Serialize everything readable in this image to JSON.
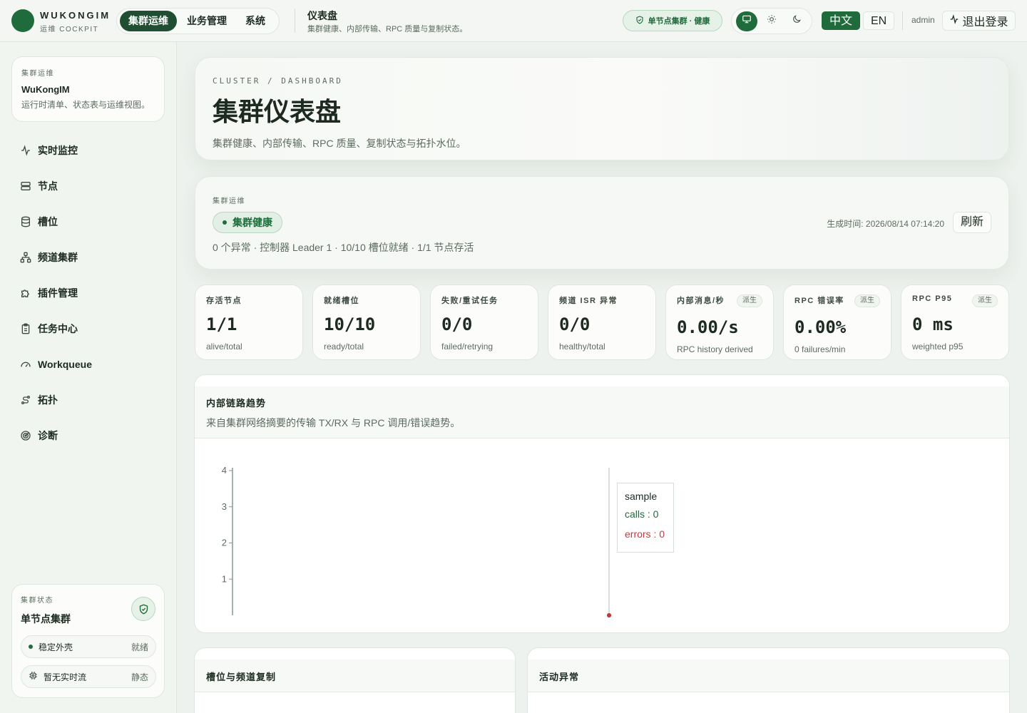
{
  "brand": {
    "name": "WUKONGIM",
    "subtitle": "运维 COCKPIT"
  },
  "topnav": {
    "items": [
      "集群运维",
      "业务管理",
      "系统"
    ],
    "active": 0
  },
  "page_head": {
    "title": "仪表盘",
    "subtitle": "集群健康、内部传输、RPC 质量与复制状态。"
  },
  "cluster_chip": {
    "label": "单节点集群 · 健康"
  },
  "theme": {
    "modes": [
      "monitor-icon",
      "sun-icon",
      "moon-icon"
    ],
    "active": 0
  },
  "lang": {
    "zh": "中文",
    "en": "EN",
    "active": "zh"
  },
  "user": {
    "name": "admin",
    "logout": "退出登录"
  },
  "sidebar": {
    "card": {
      "eyebrow": "集群运维",
      "title": "WuKongIM",
      "subtitle": "运行时清单、状态表与运维视图。"
    },
    "items": [
      {
        "label": "实时监控",
        "icon": "activity-icon"
      },
      {
        "label": "节点",
        "icon": "server-icon"
      },
      {
        "label": "槽位",
        "icon": "database-icon"
      },
      {
        "label": "频道集群",
        "icon": "network-icon"
      },
      {
        "label": "插件管理",
        "icon": "puzzle-icon"
      },
      {
        "label": "任务中心",
        "icon": "clipboard-icon"
      },
      {
        "label": "Workqueue",
        "icon": "gauge-icon"
      },
      {
        "label": "拓扑",
        "icon": "route-icon"
      },
      {
        "label": "诊断",
        "icon": "radar-icon"
      }
    ],
    "status": {
      "eyebrow": "集群状态",
      "title": "单节点集群",
      "rows": [
        {
          "label": "稳定外壳",
          "value": "就绪"
        },
        {
          "label": "暂无实时流",
          "value": "静态"
        }
      ]
    }
  },
  "hero": {
    "eyebrow": "CLUSTER / DASHBOARD",
    "title": "集群仪表盘",
    "subtitle": "集群健康、内部传输、RPC 质量、复制状态与拓扑水位。"
  },
  "ops": {
    "eyebrow": "集群运维",
    "health": "集群健康",
    "summary": "0 个异常 · 控制器 Leader 1 · 10/10 槽位就绪 · 1/1 节点存活",
    "generated_label": "生成时间:",
    "generated_at": "2026/08/14 07:14:20",
    "refresh": "刷新"
  },
  "metrics": [
    {
      "label": "存活节点",
      "value": "1/1",
      "caption": "alive/total",
      "tag": ""
    },
    {
      "label": "就绪槽位",
      "value": "10/10",
      "caption": "ready/total",
      "tag": ""
    },
    {
      "label": "失败/重试任务",
      "value": "0/0",
      "caption": "failed/retrying",
      "tag": ""
    },
    {
      "label": "频道 ISR 异常",
      "value": "0/0",
      "caption": "healthy/total",
      "tag": ""
    },
    {
      "label": "内部消息/秒",
      "value": "0.00/s",
      "caption": "RPC history derived",
      "tag": "派生"
    },
    {
      "label": "RPC 错误率",
      "value": "0.00%",
      "caption": "0 failures/min",
      "tag": "派生"
    },
    {
      "label": "RPC P95",
      "value": "0 ms",
      "caption": "weighted p95",
      "tag": "派生"
    }
  ],
  "trend": {
    "title": "内部链路趋势",
    "subtitle": "来自集群网络摘要的传输 TX/RX 与 RPC 调用/错误趋势。"
  },
  "chart_data": {
    "type": "line",
    "x": [
      "sample"
    ],
    "series": [
      {
        "name": "calls",
        "values": [
          0
        ],
        "color": "#1f6b3c"
      },
      {
        "name": "errors",
        "values": [
          0
        ],
        "color": "#c43a3a"
      }
    ],
    "yticks": [
      "1",
      "2",
      "3",
      "4"
    ],
    "ylim": [
      0,
      4
    ],
    "tooltip": {
      "title": "sample",
      "calls": "calls : 0",
      "errors": "errors : 0"
    }
  },
  "bottom": {
    "left_title": "槽位与频道复制",
    "right_title": "活动异常"
  }
}
